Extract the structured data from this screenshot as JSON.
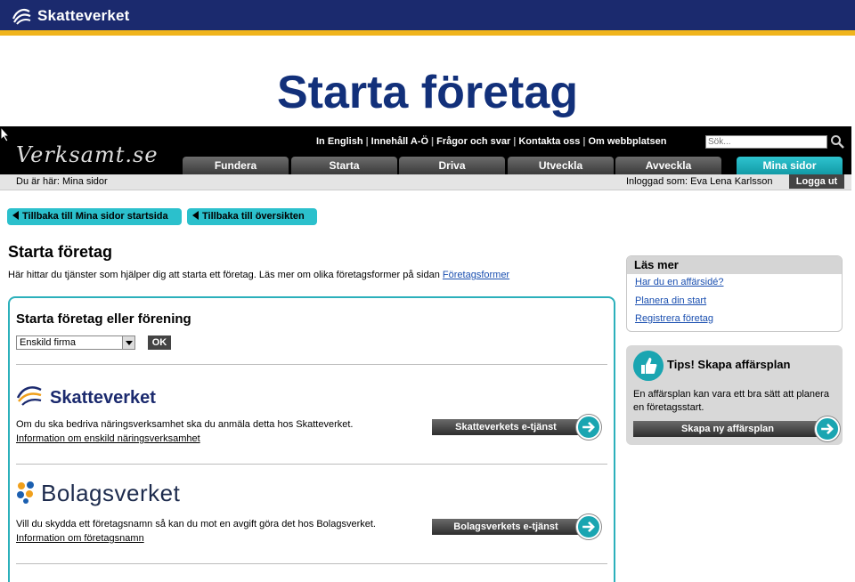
{
  "brand": {
    "name": "Skatteverket"
  },
  "slide_title": "Starta företag",
  "site": {
    "logo_text": "Verksamt.se",
    "top_links": [
      "In English",
      "Innehåll A-Ö",
      "Frågor och svar",
      "Kontakta oss",
      "Om webbplatsen"
    ],
    "search_placeholder": "Sök...",
    "tabs": [
      {
        "label": "Fundera",
        "active": false
      },
      {
        "label": "Starta",
        "active": false
      },
      {
        "label": "Driva",
        "active": false
      },
      {
        "label": "Utveckla",
        "active": false
      },
      {
        "label": "Avveckla",
        "active": false
      },
      {
        "label": "Mina sidor",
        "active": true
      }
    ],
    "breadcrumb": "Du är här: Mina sidor",
    "logged_in": "Inloggad som: Eva Lena Karlsson",
    "logout_label": "Logga ut"
  },
  "back_buttons": {
    "start": "Tillbaka till Mina sidor startsida",
    "overview": "Tillbaka till översikten"
  },
  "page": {
    "heading": "Starta företag",
    "intro_text": "Här hittar du tjänster som hjälper dig att starta ett företag. Läs mer om olika företagsformer på sidan ",
    "intro_link": "Företagsformer"
  },
  "main": {
    "title": "Starta företag eller förening",
    "select_value": "Enskild firma",
    "ok_label": "OK",
    "skatteverket": {
      "name": "Skatteverket",
      "text": "Om du ska bedriva näringsverksamhet ska du anmäla detta hos Skatteverket.",
      "link": "Information om enskild näringsverksamhet",
      "button": "Skatteverkets e-tjänst"
    },
    "bolagsverket": {
      "name": "Bolagsverket",
      "text": "Vill du skydda ett företagsnamn så kan du mot en avgift göra det hos Bolagsverket.",
      "link": "Information om företagsnamn",
      "button": "Bolagsverkets e-tjänst"
    }
  },
  "sidebar": {
    "las_mer": {
      "title": "Läs mer",
      "links": [
        "Har du en affärsidé?",
        "Planera din start",
        "Registrera företag"
      ]
    },
    "tips": {
      "title": "Tips! Skapa affärsplan",
      "text": "En affärsplan kan vara ett bra sätt att planera en företagsstart.",
      "button": "Skapa ny affärsplan"
    }
  },
  "colors": {
    "brand_blue": "#1b2a6e",
    "accent_teal": "#2bc0cc",
    "stripe_gold": "#f0b41c"
  }
}
